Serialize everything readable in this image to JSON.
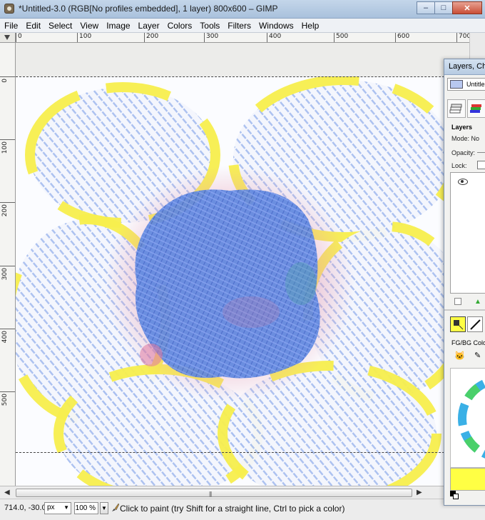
{
  "window": {
    "title": "*Untitled-3.0 (RGB[No profiles embedded], 1 layer) 800x600 – GIMP",
    "minimize": "–",
    "maximize": "□",
    "close": "✕"
  },
  "menu": [
    "File",
    "Edit",
    "Select",
    "View",
    "Image",
    "Layer",
    "Colors",
    "Tools",
    "Filters",
    "Windows",
    "Help"
  ],
  "ruler_top_labels": [
    "0",
    "100",
    "200",
    "300",
    "400",
    "500",
    "600",
    "700"
  ],
  "ruler_left_labels": [
    "0",
    "100",
    "200",
    "300",
    "400",
    "500"
  ],
  "statusbar": {
    "coords": "714.0, -30.0",
    "unit": "px",
    "zoom": "100 %",
    "message": "Click to paint (try Shift for a straight line, Ctrl to pick a color)"
  },
  "dock": {
    "title": "Layers, Cha",
    "image_selector": "Untitle",
    "layers_section": "Layers",
    "mode_label": "Mode:",
    "mode_value": "No",
    "opacity_label": "Opacity:",
    "lock_label": "Lock:",
    "fgbg_label": "FG/BG Colo",
    "fg_color": "#ffff44"
  },
  "colors": {
    "paint_blue": "#6a8fe0",
    "paint_yellow": "#f7ef4e",
    "paint_pink": "#e79bb0"
  }
}
